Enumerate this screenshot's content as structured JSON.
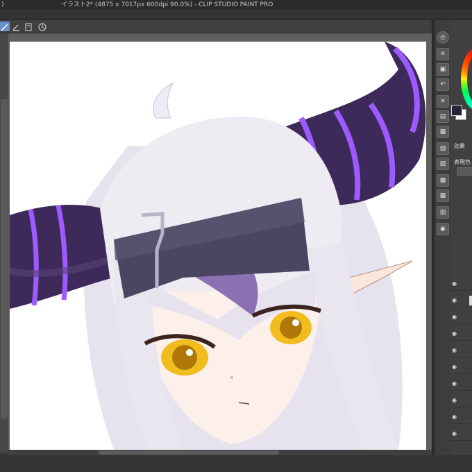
{
  "app": {
    "title": "イラスト2* (4875 x 7017px 600dpi 90.0%)  - CLIP STUDIO PAINT PRO",
    "left_mark": ")"
  },
  "right_panel": {
    "section_effect": "効果",
    "section_display_color": "表現色"
  },
  "icons": {
    "toolbar": [
      "pen-icon",
      "brush-icon",
      "page-icon",
      "rotate-icon"
    ],
    "command_bar": [
      "zoom-icon",
      "close-x-icon",
      "save-icon",
      "undo-icon",
      "redo-icon",
      "clear-icon",
      "cut-icon",
      "copy-icon",
      "paste-icon",
      "transform-icon",
      "grid-icon",
      "fill-icon",
      "camera-icon"
    ],
    "layer_visibility": "eye-icon"
  },
  "colors": {
    "main_color": "#2a2238",
    "sub_color": "#ffffff",
    "horn_purple": "#3e2a5a",
    "horn_stripe": "#9d5bff",
    "hair": "#e9e6ef",
    "eye_gold": "#f1bd1e"
  }
}
